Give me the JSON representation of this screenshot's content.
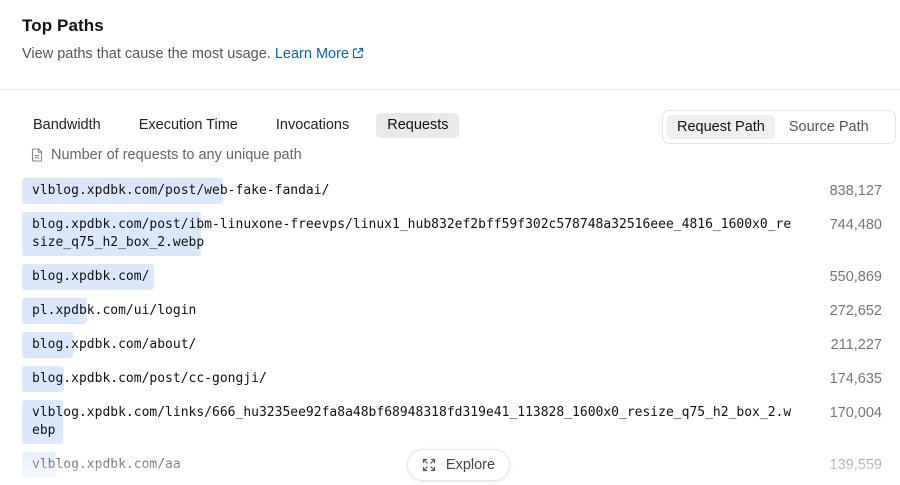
{
  "header": {
    "title": "Top Paths",
    "subtitle": "View paths that cause the most usage.",
    "learn_more": "Learn More"
  },
  "tabs": [
    {
      "label": "Bandwidth",
      "active": false
    },
    {
      "label": "Execution Time",
      "active": false
    },
    {
      "label": "Invocations",
      "active": false
    },
    {
      "label": "Requests",
      "active": true
    }
  ],
  "toggle": [
    {
      "label": "Request Path",
      "active": true
    },
    {
      "label": "Source Path",
      "active": false
    }
  ],
  "description": "Number of requests to any unique path",
  "rows": [
    {
      "path": "vlblog.xpdbk.com/post/web-fake-fandai/",
      "count": "838,127"
    },
    {
      "path": "blog.xpdbk.com/post/ibm-linuxone-freevps/linux1_hub832ef2bff59f302c578748a32516eee_4816_1600x0_resize_q75_h2_box_2.webp",
      "count": "744,480"
    },
    {
      "path": "blog.xpdbk.com/",
      "count": "550,869"
    },
    {
      "path": "pl.xpdbk.com/ui/login",
      "count": "272,652"
    },
    {
      "path": "blog.xpdbk.com/about/",
      "count": "211,227"
    },
    {
      "path": "blog.xpdbk.com/post/cc-gongji/",
      "count": "174,635"
    },
    {
      "path": "vlblog.xpdbk.com/links/666_hu3235ee92fa8a48bf68948318fd319e41_113828_1600x0_resize_q75_h2_box_2.webp",
      "count": "170,004"
    },
    {
      "path": "vlblog.xpdbk.com/aa",
      "count": "139,559"
    }
  ],
  "explore_label": "Explore"
}
